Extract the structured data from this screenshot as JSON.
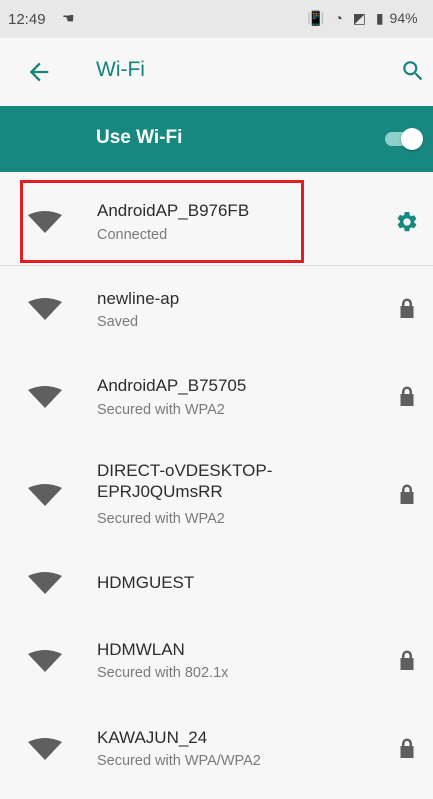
{
  "status_bar": {
    "time": "12:49",
    "battery_text": "94%"
  },
  "toolbar": {
    "title": "Wi-Fi"
  },
  "use_wifi": {
    "label": "Use Wi-Fi",
    "enabled": true
  },
  "networks": [
    {
      "name": "AndroidAP_B976FB",
      "status": "Connected",
      "icon": "gear-icon"
    },
    {
      "name": "newline-ap",
      "status": "Saved",
      "icon": "lock-icon"
    },
    {
      "name": "AndroidAP_B75705",
      "status": "Secured with WPA2",
      "icon": "lock-icon"
    },
    {
      "name_line1": "DIRECT-oVDESKTOP-",
      "name_line2": "EPRJ0QUmsRR",
      "status": "Secured with WPA2",
      "icon": "lock-icon"
    },
    {
      "name": "HDMGUEST",
      "status": "",
      "icon": "none"
    },
    {
      "name": "HDMWLAN",
      "status": "Secured with 802.1x",
      "icon": "lock-icon"
    },
    {
      "name": "KAWAJUN_24",
      "status": "Secured with WPA/WPA2",
      "icon": "lock-icon"
    }
  ],
  "colors": {
    "accent": "#16887f",
    "title_teal": "#16837b",
    "highlight": "#e02020"
  }
}
